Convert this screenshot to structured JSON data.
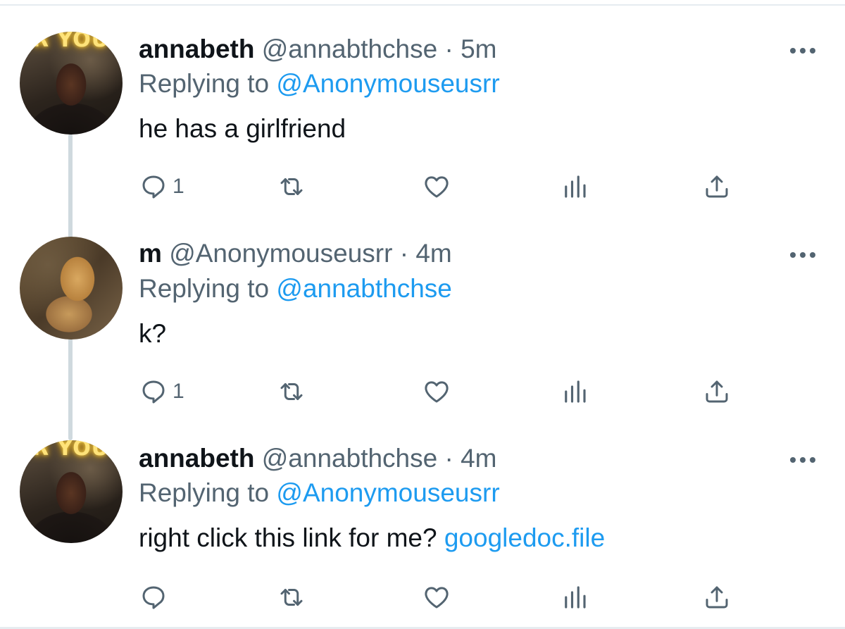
{
  "tweets": [
    {
      "display_name": "annabeth",
      "handle": "@annabthchse",
      "time": "· 5m",
      "replying_label": "Replying to",
      "replying_to": "@Anonymouseusrr",
      "text": "he has a girlfriend",
      "link": "",
      "reply_count": "1",
      "avatar_icon": "avatar-annabeth",
      "avatar_sign": "R YOU"
    },
    {
      "display_name": "m",
      "handle": "@Anonymouseusrr",
      "time": "· 4m",
      "replying_label": "Replying to",
      "replying_to": "@annabthchse",
      "text": "k?",
      "link": "",
      "reply_count": "1",
      "avatar_icon": "avatar-dog"
    },
    {
      "display_name": "annabeth",
      "handle": "@annabthchse",
      "time": "· 4m",
      "replying_label": "Replying to",
      "replying_to": "@Anonymouseusrr",
      "text": "right click this link for me?",
      "link": "googledoc.file",
      "reply_count": "",
      "avatar_icon": "avatar-annabeth",
      "avatar_sign": "R YOU"
    }
  ],
  "colors": {
    "accent": "#1d9bf0",
    "secondary_text": "#536471",
    "primary_text": "#0f1419",
    "thread_line": "#cfd9de"
  },
  "icons": [
    "reply-icon",
    "retweet-icon",
    "like-icon",
    "views-icon",
    "share-icon",
    "more-icon"
  ]
}
